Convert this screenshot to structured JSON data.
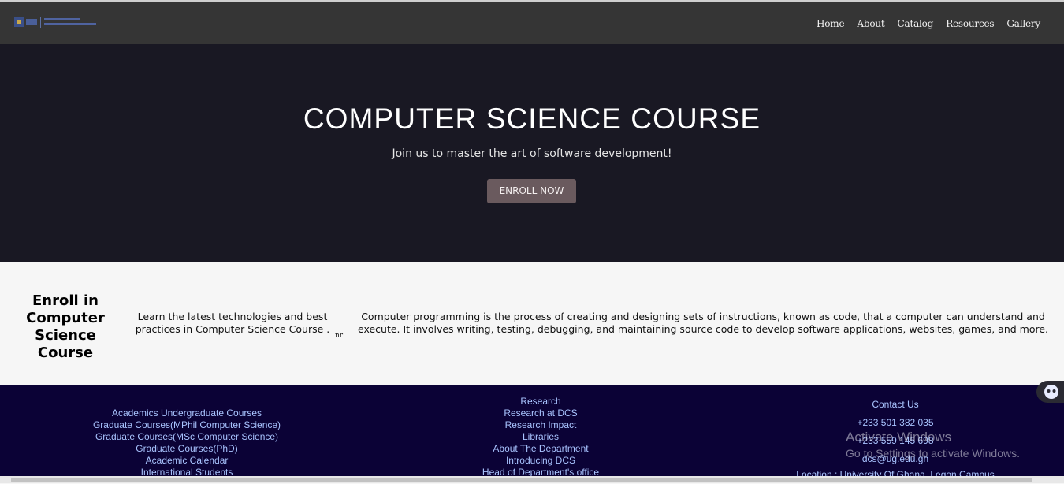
{
  "nav": {
    "logo_text": "DEPARTMENT OF COMPUTER SCIENCE",
    "items": [
      "Home",
      "About",
      "Catalog",
      "Resources",
      "Gallery"
    ]
  },
  "hero": {
    "title": "COMPUTER SCIENCE COURSE",
    "subtitle": "Join us to master the art of software development!",
    "button": "ENROLL NOW"
  },
  "content": {
    "enroll_title": "Enroll in Computer Science Course",
    "learn_text": "Learn the latest technologies and best practices in Computer Science Course .",
    "stray_text": "nr",
    "programming_text": "Computer programming is the process of creating and designing sets of instructions, known as code, that a computer can understand and execute. It involves writing, testing, debugging, and maintaining source code to develop software applications, websites, games, and more."
  },
  "footer": {
    "academics": [
      "Academics Undergraduate Courses",
      "Graduate Courses(MPhil Computer Science)",
      "Graduate Courses(MSc Computer Science)",
      "Graduate Courses(PhD)",
      "Academic Calendar",
      "International Students"
    ],
    "research": [
      "Research",
      "Research at DCS",
      "Research Impact",
      "Libraries",
      "About The Department",
      "Introducing DCS",
      "Head of Department's office"
    ],
    "contact": {
      "heading": "Contact Us",
      "phone1": "+233 501 382 035",
      "phone2": "+233 559 145 698",
      "email": "dcs@ug.edu.gh",
      "location": "Location : University Of Ghana, Legon Campus"
    }
  },
  "overlay": {
    "activate_title": "Activate Windows",
    "activate_sub": "Go to Settings to activate Windows."
  },
  "colors": {
    "navbar": "#353535",
    "hero_bg": "#191823",
    "button": "#6a5a5e",
    "footer_bg": "#0b0236",
    "footer_link": "#a9c4ff"
  }
}
